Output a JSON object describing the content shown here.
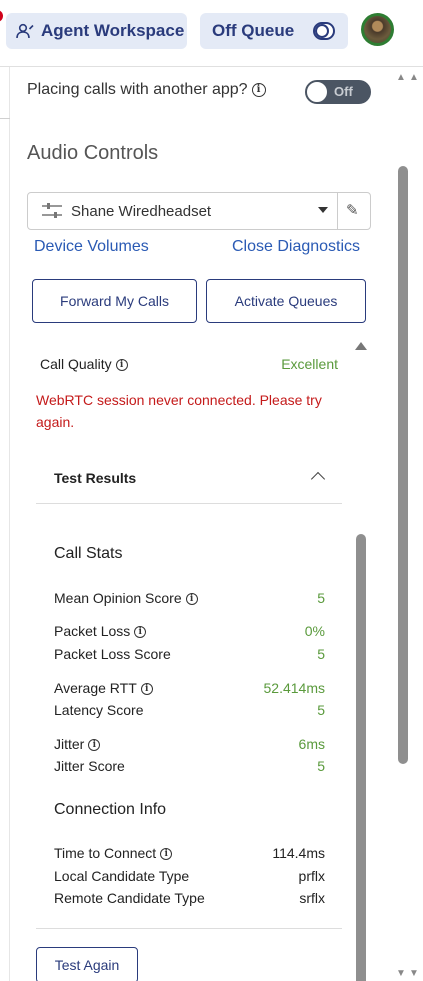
{
  "header": {
    "agent_workspace_label": "Agent Workspace",
    "queue_label": "Off Queue"
  },
  "settings": {
    "placing_calls_label": "Placing calls with another app?",
    "placing_calls_toggle": "Off",
    "audio_controls_title": "Audio Controls",
    "device_name": "Shane Wiredheadset",
    "device_volumes_link": "Device Volumes",
    "close_diagnostics_link": "Close Diagnostics",
    "forward_calls_button": "Forward My Calls",
    "activate_queues_button": "Activate Queues"
  },
  "diagnostics": {
    "call_quality_label": "Call Quality",
    "call_quality_value": "Excellent",
    "error_message": "WebRTC session never connected. Please try again.",
    "test_results_title": "Test Results",
    "call_stats_title": "Call Stats",
    "call_stats": [
      {
        "label": "Mean Opinion Score",
        "value": "5",
        "info": true
      },
      {
        "label": "Packet Loss",
        "value": "0%",
        "info": true
      },
      {
        "label": "Packet Loss Score",
        "value": "5",
        "info": false
      },
      {
        "label": "Average RTT",
        "value": "52.414ms",
        "info": true
      },
      {
        "label": "Latency Score",
        "value": "5",
        "info": false
      },
      {
        "label": "Jitter",
        "value": "6ms",
        "info": true
      },
      {
        "label": "Jitter Score",
        "value": "5",
        "info": false
      }
    ],
    "connection_info_title": "Connection Info",
    "connection_info": [
      {
        "label": "Time to Connect",
        "value": "114.4ms",
        "info": true
      },
      {
        "label": "Local Candidate Type",
        "value": "prflx",
        "info": false
      },
      {
        "label": "Remote Candidate Type",
        "value": "srflx",
        "info": false
      }
    ],
    "test_again_button": "Test Again"
  },
  "colors": {
    "brand_navy": "#2a3b7c",
    "link_blue": "#2a5ab4",
    "success_green": "#5a9a3c",
    "error_red": "#c41a1a",
    "pill_bg": "#e4eaf6"
  }
}
